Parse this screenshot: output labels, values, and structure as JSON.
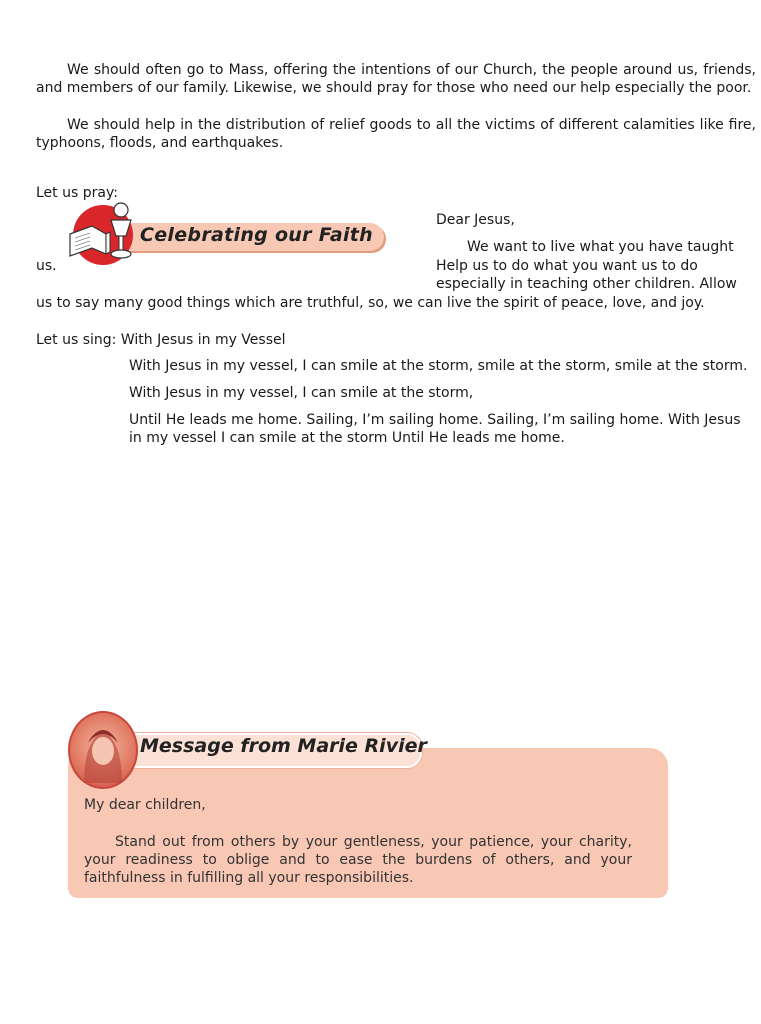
{
  "intro": {
    "p1": "We should often go to Mass, offering the intentions of our Church, the people around us, friends, and members of our family. Likewise, we should pray for those who need our help especially the poor.",
    "p2": "We should help in the distribution of relief goods to all the victims of different calamities like fire, typhoons, floods, and earthquakes."
  },
  "prayer": {
    "lead": "Let us pray:",
    "salutation": "Dear Jesus,",
    "line1": "We want to live what you have taught",
    "us": "us.",
    "line2": "Help us to do what you want us to do",
    "line3": "especially in teaching other children. Allow",
    "line4": "us to say many good things which are truthful, so, we can live the spirit of peace, love, and joy."
  },
  "badge": {
    "title": "Celebrating our Faith",
    "icon": "bible-chalice-icon"
  },
  "song": {
    "lead": "Let us sing: With Jesus in my Vessel",
    "lines": [
      "With Jesus in my vessel, I can smile at the storm, smile at the storm, smile at the storm.",
      "With Jesus in my vessel, I can smile at the storm,",
      "Until He leads me home. Sailing, I’m sailing home. Sailing, I’m sailing home. With Jesus in my vessel I can smile at the storm Until He leads me home."
    ]
  },
  "message": {
    "title": "Message from Marie Rivier",
    "greeting": "My dear children,",
    "body": "Stand out from others by your gentleness, your patience, your charity, your readiness to oblige and to ease the burdens of others, and your faithfulness in fulfilling all your responsibilities."
  },
  "colors": {
    "accent_red": "#d9262b",
    "pill_pink": "#f7c9b4",
    "box_pink": "#f8c8b5"
  }
}
